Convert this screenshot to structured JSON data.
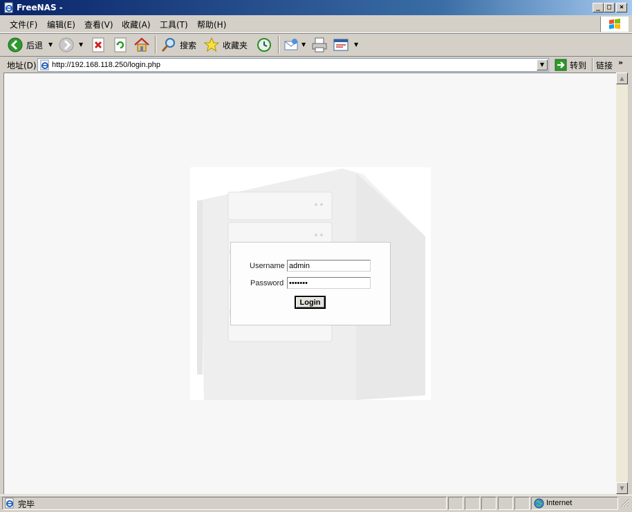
{
  "window": {
    "title": "FreeNAS -"
  },
  "menu": {
    "items": [
      {
        "label": "文件(F)"
      },
      {
        "label": "编辑(E)"
      },
      {
        "label": "查看(V)"
      },
      {
        "label": "收藏(A)"
      },
      {
        "label": "工具(T)"
      },
      {
        "label": "帮助(H)"
      }
    ]
  },
  "toolbar": {
    "back_label": "后退",
    "search_label": "搜索",
    "favorites_label": "收藏夹"
  },
  "address": {
    "label": "地址(D)",
    "url": "http://192.168.118.250/login.php",
    "go_label": "转到",
    "links_label": "链接"
  },
  "login": {
    "username_label": "Username",
    "username_value": "admin",
    "password_label": "Password",
    "password_value": "•••••••",
    "button_label": "Login"
  },
  "status": {
    "text": "完毕",
    "zone": "Internet"
  },
  "colors": {
    "titlebar_start": "#0a246a",
    "titlebar_end": "#a6caf0",
    "chrome": "#d4d0c8",
    "page_bg": "#f7f7f7"
  }
}
